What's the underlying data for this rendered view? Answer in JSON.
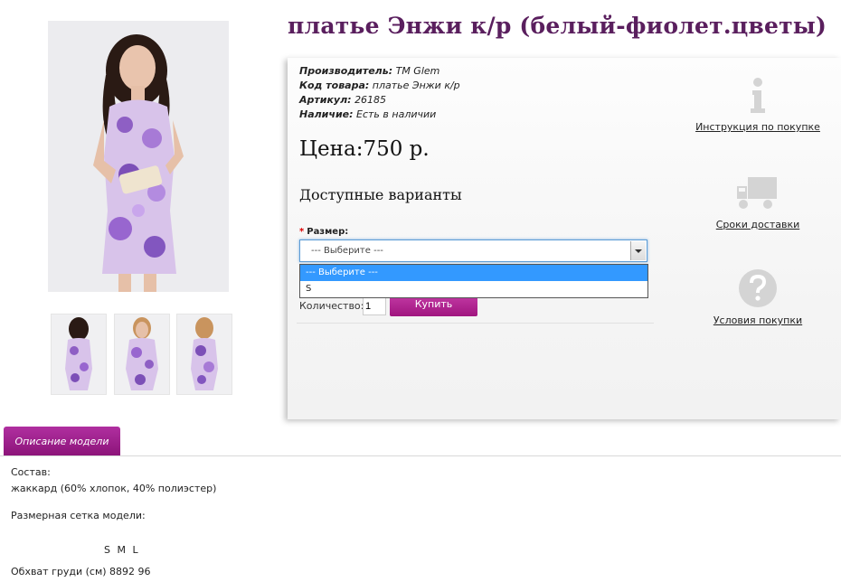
{
  "title": "платье Энжи к/р (белый-фиолет.цветы)",
  "meta": {
    "manufacturer_key": "Производитель:",
    "manufacturer_val": "TM Glem",
    "code_key": "Код товара:",
    "code_val": "платье Энжи к/р",
    "sku_key": "Артикул:",
    "sku_val": "26185",
    "stock_key": "Наличие:",
    "stock_val": "Есть в наличии"
  },
  "price": "Цена:750 р.",
  "variants_heading": "Доступные варианты",
  "size_label": "Размер:",
  "size_required": "*",
  "select_value": "--- Выберите ---",
  "select_options": [
    "--- Выберите ---",
    "S"
  ],
  "qty_label": "Количество:",
  "qty_value": "1",
  "buy_label": "Купить",
  "side": {
    "instructions": "Инструкция по покупке",
    "delivery": "Сроки доставки",
    "conditions": "Условия покупки"
  },
  "tab_label": "Описание модели",
  "description": {
    "composition_label": "Состав:",
    "composition_value": "жаккард (60% хлопок, 40% полиэстер)",
    "size_chart_label": "Размерная сетка модели:",
    "size_header": "S M L",
    "chest_row": "Обхват груди (см) 8892 96"
  },
  "colors": {
    "title": "#5a1f5e",
    "accent": "#a0157f",
    "select_highlight": "#3399ff",
    "dress_main": "#b48ad6"
  },
  "icons": [
    "info-icon",
    "truck-icon",
    "question-icon"
  ]
}
